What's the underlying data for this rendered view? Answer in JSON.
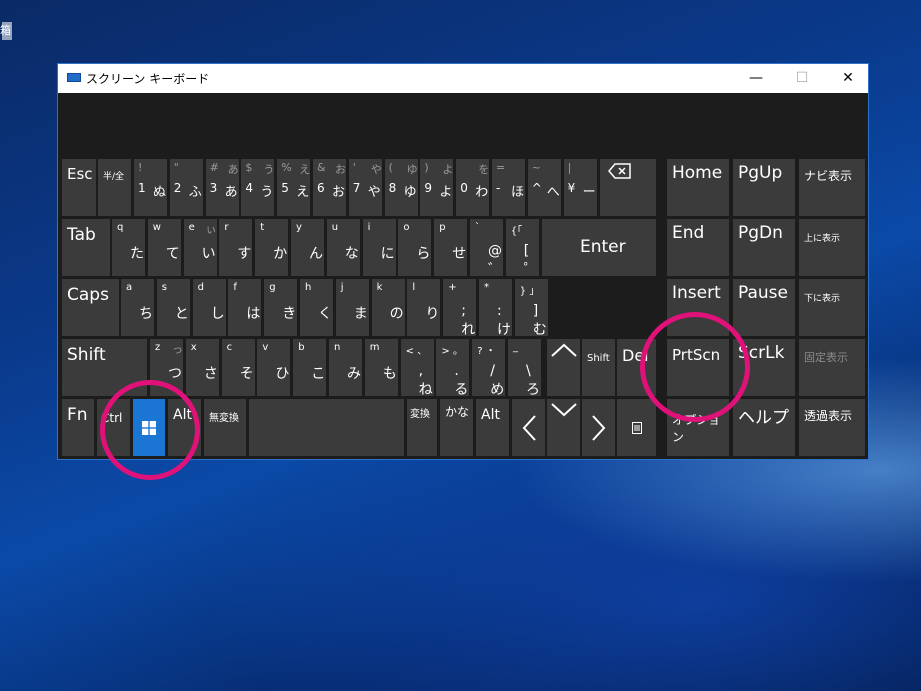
{
  "desktop": {
    "icon_label": "箱"
  },
  "window": {
    "title": "スクリーン キーボード",
    "min": "—",
    "max": "☐",
    "close": "✕"
  },
  "keys": {
    "esc": "Esc",
    "hankaku": "半/全",
    "r1": [
      {
        "tl": "!",
        "bl": "1",
        "br": "ぬ"
      },
      {
        "tl": "\"",
        "bl": "2",
        "br": "ふ"
      },
      {
        "tl": "#",
        "tr": "あ",
        "bl": "3",
        "br": "あ"
      },
      {
        "tl": "$",
        "tr": "う",
        "bl": "4",
        "br": "う"
      },
      {
        "tl": "%",
        "tr": "え",
        "bl": "5",
        "br": "え"
      },
      {
        "tl": "&",
        "tr": "お",
        "bl": "6",
        "br": "お"
      },
      {
        "tl": "'",
        "tr": "や",
        "bl": "7",
        "br": "や"
      },
      {
        "tl": "(",
        "tr": "ゆ",
        "bl": "8",
        "br": "ゆ"
      },
      {
        "tl": ")",
        "tr": "よ",
        "bl": "9",
        "br": "よ"
      },
      {
        "tl": "",
        "tr": "を",
        "bl": "0",
        "br": "わ"
      },
      {
        "tl": "=",
        "bl": "-",
        "br": "ほ"
      },
      {
        "tl": "~",
        "bl": "^",
        "br": "へ"
      },
      {
        "tl": "|",
        "bl": "¥",
        "br": "ー"
      }
    ],
    "tab": "Tab",
    "r2": [
      {
        "a": "q",
        "k": "た"
      },
      {
        "a": "w",
        "k": "て"
      },
      {
        "a": "e",
        "tr": "ぃ",
        "k": "い"
      },
      {
        "a": "r",
        "k": "す"
      },
      {
        "a": "t",
        "k": "か"
      },
      {
        "a": "y",
        "k": "ん"
      },
      {
        "a": "u",
        "k": "な"
      },
      {
        "a": "i",
        "k": "に"
      },
      {
        "a": "o",
        "k": "ら"
      },
      {
        "a": "p",
        "k": "せ"
      },
      {
        "a": "`",
        "k": "@ ゛"
      },
      {
        "a": "{「",
        "k": "[ ゜"
      }
    ],
    "enter": "Enter",
    "caps": "Caps",
    "r3": [
      {
        "a": "a",
        "k": "ち"
      },
      {
        "a": "s",
        "k": "と"
      },
      {
        "a": "d",
        "k": "し"
      },
      {
        "a": "f",
        "k": "は"
      },
      {
        "a": "g",
        "k": "き"
      },
      {
        "a": "h",
        "k": "く"
      },
      {
        "a": "j",
        "k": "ま"
      },
      {
        "a": "k",
        "k": "の"
      },
      {
        "a": "l",
        "k": "り"
      },
      {
        "a": "+",
        "k": "; れ"
      },
      {
        "a": "*",
        "k": ": け"
      },
      {
        "a": "} 」",
        "k": "] む"
      }
    ],
    "shift": "Shift",
    "r4": [
      {
        "a": "z",
        "tr": "っ",
        "k": "つ"
      },
      {
        "a": "x",
        "k": "さ"
      },
      {
        "a": "c",
        "k": "そ"
      },
      {
        "a": "v",
        "k": "ひ"
      },
      {
        "a": "b",
        "k": "こ"
      },
      {
        "a": "n",
        "k": "み"
      },
      {
        "a": "m",
        "k": "も"
      },
      {
        "a": "< 、",
        "k": ", ね"
      },
      {
        "a": "> 。",
        "k": ". る"
      },
      {
        "a": "? ・",
        "k": "/ め"
      },
      {
        "a": "_",
        "k": "\\ ろ"
      }
    ],
    "shift_r": "Shift",
    "del": "Del",
    "fn": "Fn",
    "ctrl": "Ctrl",
    "alt": "Alt",
    "muhenkan": "無変換",
    "henkan": "変換",
    "kana": "かな",
    "alt_r": "Alt",
    "home": "Home",
    "pgup": "PgUp",
    "navi": "ナビ表示",
    "end": "End",
    "pgdn": "PgDn",
    "up_display": "上に表示",
    "insert": "Insert",
    "pause": "Pause",
    "down_display": "下に表示",
    "prtscn": "PrtScn",
    "scrlk": "ScrLk",
    "fixed_display": "固定表示",
    "options": "オプション",
    "help": "ヘルプ",
    "fade": "透過表示"
  },
  "annotation_color": "#e0127a"
}
